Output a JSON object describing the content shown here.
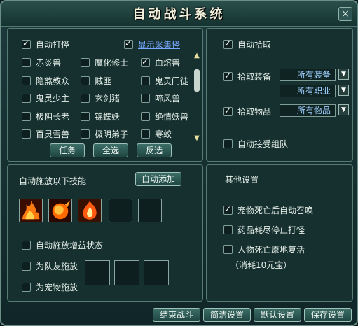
{
  "window": {
    "title": "自动战斗系统",
    "close_glyph": "×"
  },
  "monsters": {
    "auto_attack_label": "自动打怪",
    "show_gather_label": "显示采集怪",
    "items": [
      {
        "label": "赤炎兽",
        "checked": false
      },
      {
        "label": "魔化修士",
        "checked": false
      },
      {
        "label": "血熔兽",
        "checked": true
      },
      {
        "label": "隐煞教众",
        "checked": false
      },
      {
        "label": "贼匪",
        "checked": false
      },
      {
        "label": "鬼灵门徒",
        "checked": false
      },
      {
        "label": "鬼灵少主",
        "checked": false
      },
      {
        "label": "玄剑猪",
        "checked": false
      },
      {
        "label": "啼风兽",
        "checked": false
      },
      {
        "label": "极阴长老",
        "checked": false
      },
      {
        "label": "锦蝶妖",
        "checked": false
      },
      {
        "label": "绝情妖兽",
        "checked": false
      },
      {
        "label": "百灵雪兽",
        "checked": false
      },
      {
        "label": "极阴弟子",
        "checked": false
      },
      {
        "label": "寒蛟",
        "checked": false
      }
    ],
    "buttons": {
      "task": "任务",
      "select_all": "全选",
      "invert": "反选"
    },
    "scroll_up": "▲",
    "scroll_down": "▼"
  },
  "pickup": {
    "auto_pickup": "自动拾取",
    "pickup_equipment": "拾取装备",
    "equip_select_1": "所有装备",
    "equip_select_2": "所有职业",
    "pickup_items": "拾取物品",
    "item_select": "所有物品",
    "auto_accept_team": "自动接受组队",
    "dropdown_arrow": "▼"
  },
  "skills": {
    "title": "自动施放以下技能",
    "auto_add": "自动添加",
    "auto_buff": "自动施放增益状态",
    "for_team": "为队友施放",
    "for_pet": "为宠物施放"
  },
  "other": {
    "title": "其他设置",
    "pet_summon": "宠物死亡后自动召唤",
    "stop_on_empty": "药品耗尽停止打怪",
    "revive": "人物死亡原地复活",
    "cost": "（消耗10元宝）"
  },
  "footer": {
    "end_battle": "结束战斗",
    "simple_settings": "简洁设置",
    "default_settings": "默认设置",
    "save_settings": "保存设置"
  }
}
